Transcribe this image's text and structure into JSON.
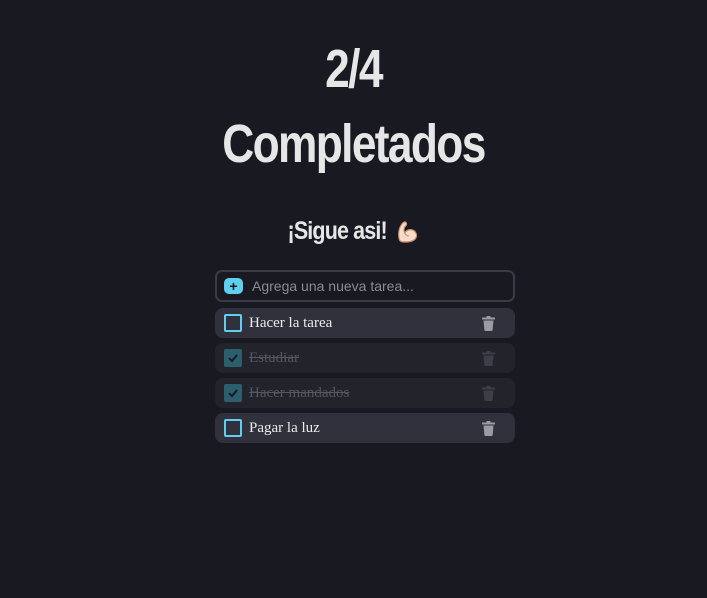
{
  "header": {
    "count": "2/4",
    "label": "Completados",
    "motivation": "¡Sigue asi!",
    "motivation_icon": "flexed-biceps-icon"
  },
  "new_task": {
    "add_symbol": "+",
    "placeholder": "Agrega una nueva tarea..."
  },
  "tasks": [
    {
      "text": "Hacer la tarea",
      "completed": false
    },
    {
      "text": "Estudiar",
      "completed": true
    },
    {
      "text": "Hacer mandados",
      "completed": true
    },
    {
      "text": "Pagar la luz",
      "completed": false
    }
  ],
  "colors": {
    "background": "#191a21",
    "accent": "#5fcff0",
    "task_active_bg": "#30313c",
    "task_done_bg": "#22232b",
    "text": "#ececec",
    "muted_text": "#555661"
  }
}
